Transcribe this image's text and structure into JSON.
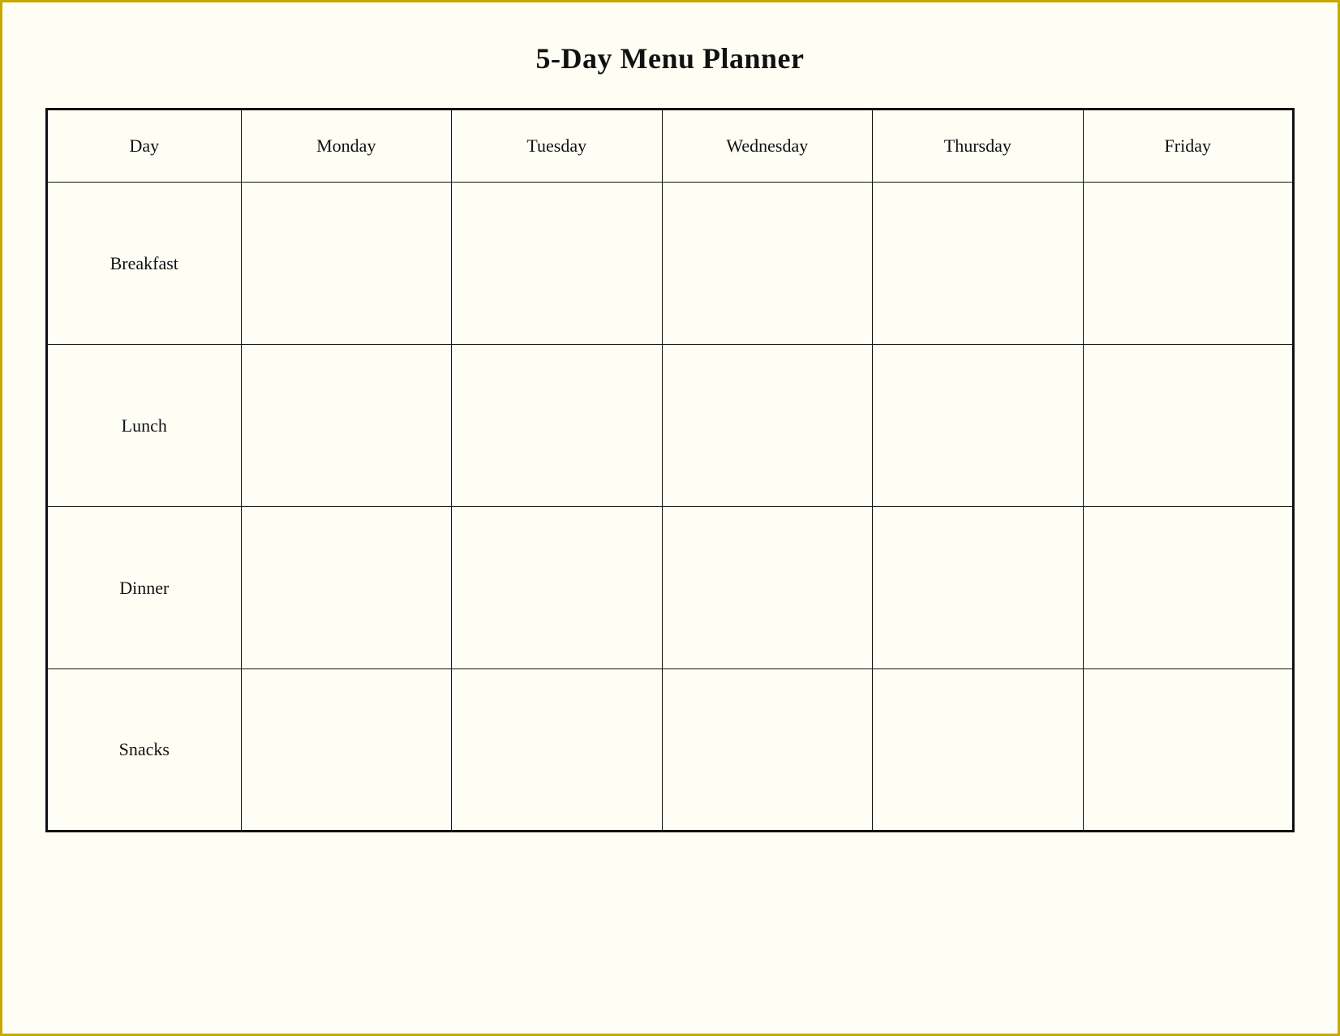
{
  "title": "5-Day Menu Planner",
  "header": {
    "col_day": "Day",
    "col_monday": "Monday",
    "col_tuesday": "Tuesday",
    "col_wednesday": "Wednesday",
    "col_thursday": "Thursday",
    "col_friday": "Friday"
  },
  "rows": [
    {
      "label": "Breakfast"
    },
    {
      "label": "Lunch"
    },
    {
      "label": "Dinner"
    },
    {
      "label": "Snacks"
    }
  ]
}
